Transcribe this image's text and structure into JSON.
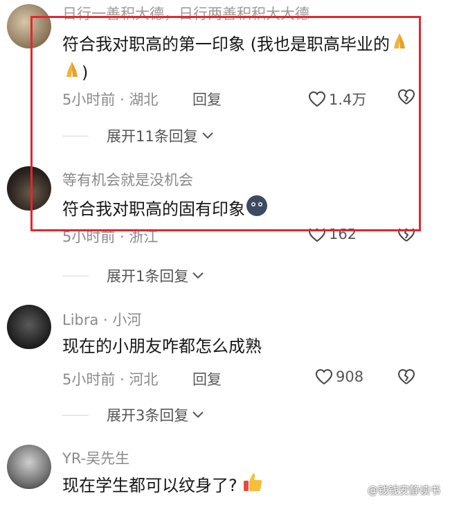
{
  "comments": [
    {
      "username": "日行一善积大德，日行两善积积大大德",
      "content": "符合我对职高的第一印象 (我也是职高毕业的",
      "content_tail": ")",
      "emoji": "folded-hands",
      "time_location": "5小时前 · 湖北",
      "reply": "回复",
      "likes": "1.4万",
      "expand": "展开11条回复"
    },
    {
      "username": "等有机会就是没机会",
      "content": "符合我对职高的固有印象",
      "emoji": "round-face",
      "time_location": "5小时前 · 浙江",
      "reply": "回复",
      "likes": "162",
      "expand": "展开1条回复"
    },
    {
      "username": "Libra · 小河",
      "content": "现在的小朋友咋都怎么成熟",
      "time_location": "5小时前 · 河北",
      "reply": "回复",
      "likes": "908",
      "expand": "展开3条回复"
    },
    {
      "username": "YR-吴先生",
      "content": "现在学生都可以纹身了?",
      "emoji": "thumbs-up"
    }
  ],
  "watermark": "@钱钱安静读书",
  "colors": {
    "highlight": "#e3262f",
    "meta": "#8a8a8a",
    "text": "#161616"
  }
}
